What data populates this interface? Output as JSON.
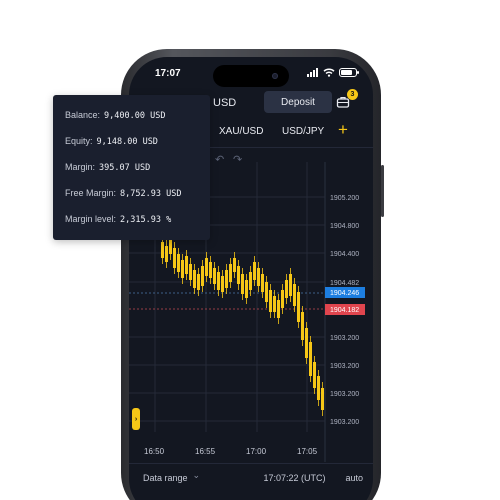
{
  "status_bar": {
    "time": "17:07"
  },
  "header": {
    "currency": "USD",
    "deposit_label": "Deposit",
    "notifications_badge": "3"
  },
  "tabs": [
    {
      "label": "XAU/USD"
    },
    {
      "label": "USD/JPY"
    }
  ],
  "account_popup": {
    "rows": [
      {
        "label": "Balance:",
        "value": "9,400.00 USD"
      },
      {
        "label": "Equity:",
        "value": "9,148.00 USD"
      },
      {
        "label": "Margin:",
        "value": "395.07 USD"
      },
      {
        "label": "Free Margin:",
        "value": "8,752.93 USD"
      },
      {
        "label": "Margin level:",
        "value": "2,315.93 %"
      }
    ]
  },
  "chart": {
    "y_labels": [
      "1905.200",
      "1904.800",
      "1904.400",
      "1904.482",
      "1903.200",
      "1903.200",
      "1903.200",
      "1903.200"
    ],
    "ask_price": "1904.246",
    "bid_price": "1904.182",
    "x_labels": [
      "16:50",
      "16:55",
      "17:00",
      "17:05"
    ],
    "colors": {
      "candle": "#f6c717",
      "ask_tag": "#1d7ee0",
      "bid_tag": "#e0454e",
      "grid": "#252a37"
    }
  },
  "bottom_bar": {
    "data_range_label": "Data range",
    "chevron": "⌄",
    "time": "17:07:22 (UTC)",
    "auto_label": "auto"
  }
}
